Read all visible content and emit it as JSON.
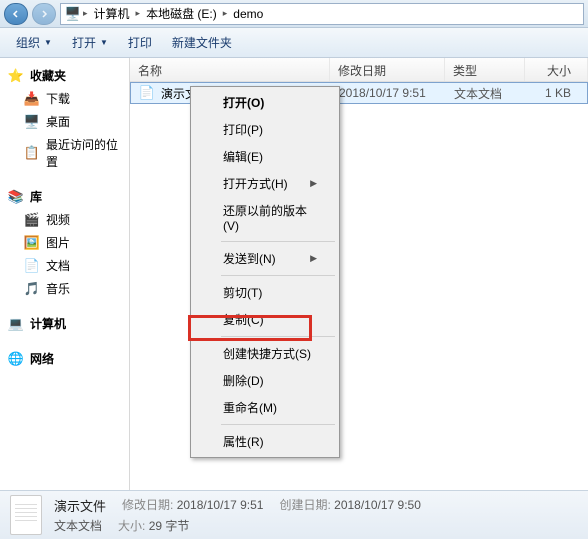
{
  "address": {
    "root_icon_alt": "computer-icon",
    "segments": [
      "计算机",
      "本地磁盘 (E:)",
      "demo"
    ]
  },
  "toolbar": {
    "organize": "组织",
    "open": "打开",
    "print": "打印",
    "new_folder": "新建文件夹"
  },
  "sidebar": {
    "favorites": {
      "label": "收藏夹",
      "items": [
        "下载",
        "桌面",
        "最近访问的位置"
      ]
    },
    "libraries": {
      "label": "库",
      "items": [
        "视频",
        "图片",
        "文档",
        "音乐"
      ]
    },
    "computer": {
      "label": "计算机"
    },
    "network": {
      "label": "网络"
    }
  },
  "columns": {
    "name": "名称",
    "date": "修改日期",
    "type": "类型",
    "size": "大小"
  },
  "file": {
    "name": "演示文件",
    "date": "2018/10/17 9:51",
    "type": "文本文档",
    "size": "1 KB"
  },
  "context_menu": {
    "open": "打开(O)",
    "print": "打印(P)",
    "edit": "编辑(E)",
    "open_with": "打开方式(H)",
    "restore_previous": "还原以前的版本(V)",
    "send_to": "发送到(N)",
    "cut": "剪切(T)",
    "copy": "复制(C)",
    "create_shortcut": "创建快捷方式(S)",
    "delete": "删除(D)",
    "rename": "重命名(M)",
    "properties": "属性(R)"
  },
  "status": {
    "title": "演示文件",
    "subtitle": "文本文档",
    "mod_label": "修改日期:",
    "mod_value": "2018/10/17 9:51",
    "create_label": "创建日期:",
    "create_value": "2018/10/17 9:50",
    "size_label": "大小:",
    "size_value": "29 字节"
  }
}
